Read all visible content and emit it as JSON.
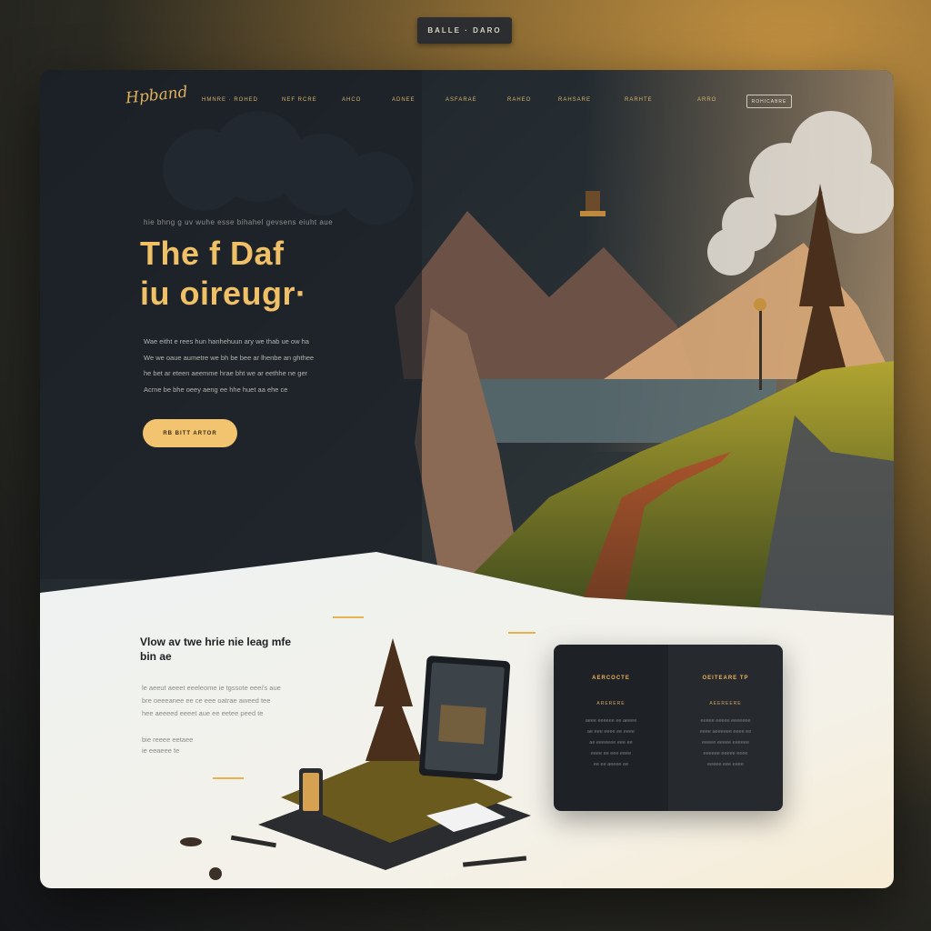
{
  "top_bar": {
    "label": "BALLE · DARO"
  },
  "brand": {
    "logo_text": "Hpband"
  },
  "nav": {
    "items": [
      "HMNRE · ROHED",
      "NEF RCRE",
      "AHCO",
      "ADNEE",
      "ASFARAE",
      "RAHEO",
      "RAHSARE",
      "RARHTE",
      "ARRO"
    ],
    "cta": "ROHICABRE"
  },
  "hero": {
    "eyebrow": "hie bhng g uv wuhe esse bihahel gevsens eiuht aue",
    "title_line1": "The f Daf",
    "title_line2": "iu oireugr·",
    "body_lines": [
      "Wae eitht e rees hun hanhehuun ary we thab ue ow ha",
      "We we oaue aumetre we bh be bee ar lhenbe an ghthee",
      "he bet ar eteen aeemme hrae bht we ar eethhe ne ger",
      "Acrne be bhe oeey aeng ee hhe huet aa ehe ce"
    ],
    "button_label": "RB BITT ARTOR"
  },
  "section": {
    "title_line1": "Vlow av twe hrie nie leag mfe",
    "title_line2": "bin ae",
    "body_lines": [
      "le aeeut aeeet eeeleome ie tgssote eeei's aue",
      "bre oeeeanee ee ce eee oatrae aweed tee",
      "hee aeeeed eeeet aue ee eetee peed te"
    ],
    "link_lines": [
      "bie reeee eetaee",
      "ie eeaeee te"
    ]
  },
  "info_panel": {
    "col1": {
      "heading": "AERCOCTE",
      "sub": "ARERERE",
      "lines": [
        "aeee eeeeee ee aeeee",
        "ae eee eeee ee eeee",
        "ae eeeeeee eee ee",
        "eeee ee eee eeee",
        "ee ee aeeee ee"
      ]
    },
    "col2": {
      "heading": "OEITEARE TP",
      "sub": "AEEREERE",
      "lines": [
        "eeeee eeeee eeeeeee",
        "eeee aeeeeee eeee ee",
        "eeeee eeeee eeeeee",
        "eeeeee eeeee eeee",
        "eeeee eee eeee"
      ]
    }
  },
  "colors": {
    "accent": "#f2c46f",
    "dark_bg": "#1b2127",
    "light_bg": "#eef0ee"
  },
  "icons": [
    "mountain-scene-illustration",
    "tablet-device-illustration"
  ]
}
